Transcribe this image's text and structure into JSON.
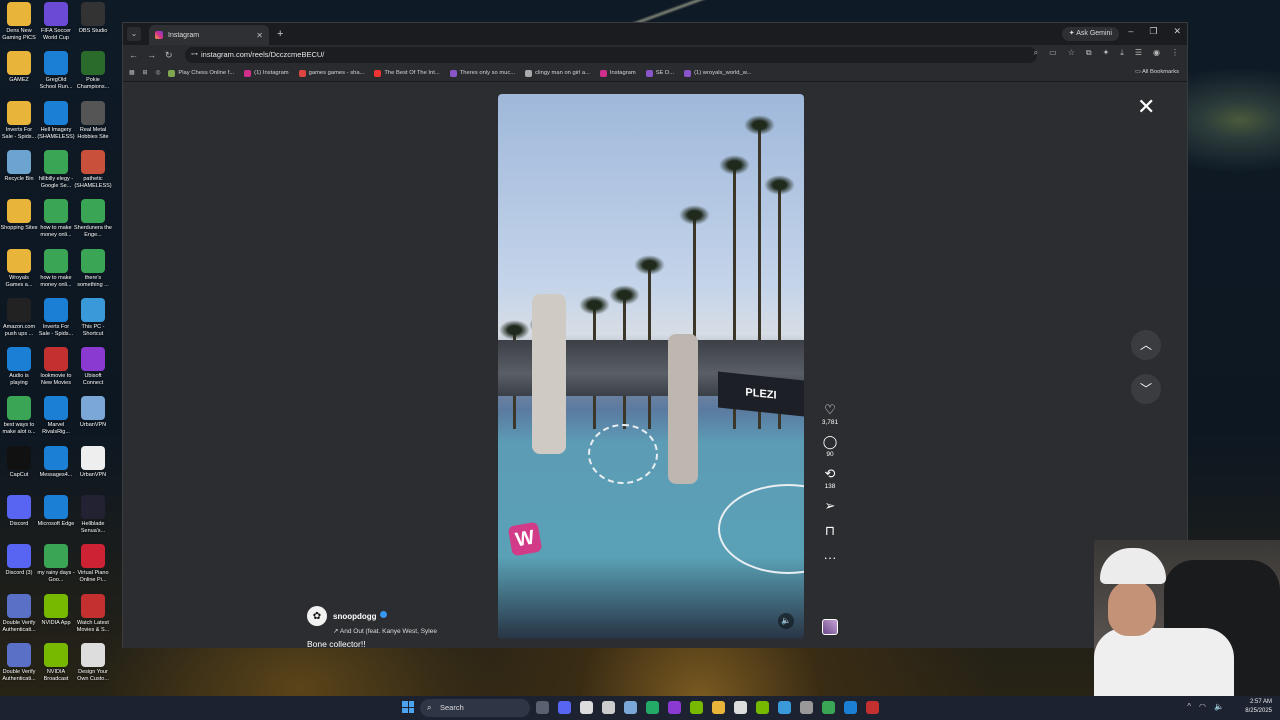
{
  "desktop": {
    "icons": [
      {
        "label": "Dens New Gaming PICS",
        "icon": "folder-icon",
        "color": "#e8b43a"
      },
      {
        "label": "FIFA Soccer World Cup",
        "icon": "fifa-icon",
        "color": "#6b4bd6"
      },
      {
        "label": "OBS Studio",
        "icon": "obs-icon",
        "color": "#333"
      },
      {
        "label": "GAMEZ",
        "icon": "folder-icon",
        "color": "#e8b43a"
      },
      {
        "label": "GregOld School Run...",
        "icon": "edge-icon",
        "color": "#1b7fd6"
      },
      {
        "label": "Pokie Champions...",
        "icon": "poker-icon",
        "color": "#2a6a2a"
      },
      {
        "label": "Inverts For Sale - Spids...",
        "icon": "folder-icon",
        "color": "#e8b43a"
      },
      {
        "label": "Hell Imagery (SHAMELESS)",
        "icon": "edge-icon",
        "color": "#1b7fd6"
      },
      {
        "label": "Real Metal Hobbies Site",
        "icon": "app-icon",
        "color": "#555"
      },
      {
        "label": "Recycle Bin",
        "icon": "recycle-bin-icon",
        "color": "#6da3cf"
      },
      {
        "label": "hillbilly elegy - Google Se...",
        "icon": "chrome-icon",
        "color": "#3aa655"
      },
      {
        "label": "pathetic (SHAMELESS)",
        "icon": "app-icon",
        "color": "#c9503a"
      },
      {
        "label": "Shopping Sites",
        "icon": "folder-icon",
        "color": "#e8b43a"
      },
      {
        "label": "how to make money onli...",
        "icon": "chrome-icon",
        "color": "#3aa655"
      },
      {
        "label": "Sherdunera the Enge...",
        "icon": "chrome-icon",
        "color": "#3aa655"
      },
      {
        "label": "Wroyals Games a...",
        "icon": "folder-icon",
        "color": "#e8b43a"
      },
      {
        "label": "how to make money onli...",
        "icon": "chrome-icon",
        "color": "#3aa655"
      },
      {
        "label": "there's something ...",
        "icon": "chrome-icon",
        "color": "#3aa655"
      },
      {
        "label": "Amazon.com push ups ...",
        "icon": "amazon-icon",
        "color": "#222"
      },
      {
        "label": "Inverts For Sale - Spids...",
        "icon": "edge-icon",
        "color": "#1b7fd6"
      },
      {
        "label": "This PC - Shortcut",
        "icon": "pc-icon",
        "color": "#3a9ad9"
      },
      {
        "label": "Audio is playing",
        "icon": "edge-icon",
        "color": "#1b7fd6"
      },
      {
        "label": "lookmovie to New Movies",
        "icon": "lm-icon",
        "color": "#c43030"
      },
      {
        "label": "Ubisoft Connect",
        "icon": "ubisoft-icon",
        "color": "#8a3ad0"
      },
      {
        "label": "best ways to make alot o...",
        "icon": "chrome-icon",
        "color": "#3aa655"
      },
      {
        "label": "Marvel RivalsRig...",
        "icon": "edge-icon",
        "color": "#1b7fd6"
      },
      {
        "label": "UrbanVPN",
        "icon": "vpn-icon",
        "color": "#7aa7d6"
      },
      {
        "label": "CapCut",
        "icon": "capcut-icon",
        "color": "#111"
      },
      {
        "label": "Messages4...",
        "icon": "edge-icon",
        "color": "#1b7fd6"
      },
      {
        "label": "UrbanVPN",
        "icon": "file-icon",
        "color": "#eee"
      },
      {
        "label": "Discord",
        "icon": "discord-icon",
        "color": "#5865f2"
      },
      {
        "label": "Microsoft Edge",
        "icon": "edge-icon",
        "color": "#1b7fd6"
      },
      {
        "label": "Hellblade Senua's...",
        "icon": "game-icon",
        "color": "#223"
      },
      {
        "label": "Discord (3)",
        "icon": "discord-icon",
        "color": "#5865f2"
      },
      {
        "label": "my rainy days - Goo...",
        "icon": "chrome-icon",
        "color": "#3aa655"
      },
      {
        "label": "Virtual Piano Online Pi...",
        "icon": "piano-icon",
        "color": "#c23"
      },
      {
        "label": "Double Verify Authenticati...",
        "icon": "shield-icon",
        "color": "#5a6fc6"
      },
      {
        "label": "NVIDIA App",
        "icon": "nvidia-icon",
        "color": "#76b900"
      },
      {
        "label": "Watch Latest Movies & S...",
        "icon": "lm-icon",
        "color": "#c43030"
      },
      {
        "label": "Double Verify Authenticati...",
        "icon": "shield-icon",
        "color": "#5a6fc6"
      },
      {
        "label": "NVIDIA Broadcast",
        "icon": "nvidia-icon",
        "color": "#76b900"
      },
      {
        "label": "Design Your Own Custo...",
        "icon": "app-icon",
        "color": "#ddd"
      }
    ]
  },
  "browser": {
    "tab_title": "Instagram",
    "ask_gemini": "Ask Gemini",
    "url": "instagram.com/reels/DcczcmeBECU/",
    "bookmarks": [
      {
        "label": "Play Chess Online f...",
        "color": "#7fa650"
      },
      {
        "label": "(1) Instagram",
        "color": "#d0308c"
      },
      {
        "label": "games games - sha...",
        "color": "#d44"
      },
      {
        "label": "The Best Of The Int...",
        "color": "#e33"
      },
      {
        "label": "Theres only so muc...",
        "color": "#8a55c9"
      },
      {
        "label": "clingy man on girl a...",
        "color": "#aaa"
      },
      {
        "label": "Instagram",
        "color": "#d0308c"
      },
      {
        "label": "SE D...",
        "color": "#8a55c9"
      },
      {
        "label": "(1) wroyals_world_w...",
        "color": "#8a55c9"
      }
    ],
    "all_bookmarks": "All Bookmarks"
  },
  "reel": {
    "likes": "3,781",
    "comments": "90",
    "reposts": "138",
    "username": "snoopdogg",
    "song": "And Out (feat. Kanye West, Sylee",
    "caption": "Bone collector!!",
    "banner_text": "PLEZI",
    "badge_text": "W"
  },
  "taskbar": {
    "search_placeholder": "Search",
    "time": "2:57 AM",
    "date": "8/25/2025"
  },
  "colors": {
    "page_bg": "#2b2d30",
    "accent_instagram": "#d0308c",
    "verified": "#3897f0"
  }
}
